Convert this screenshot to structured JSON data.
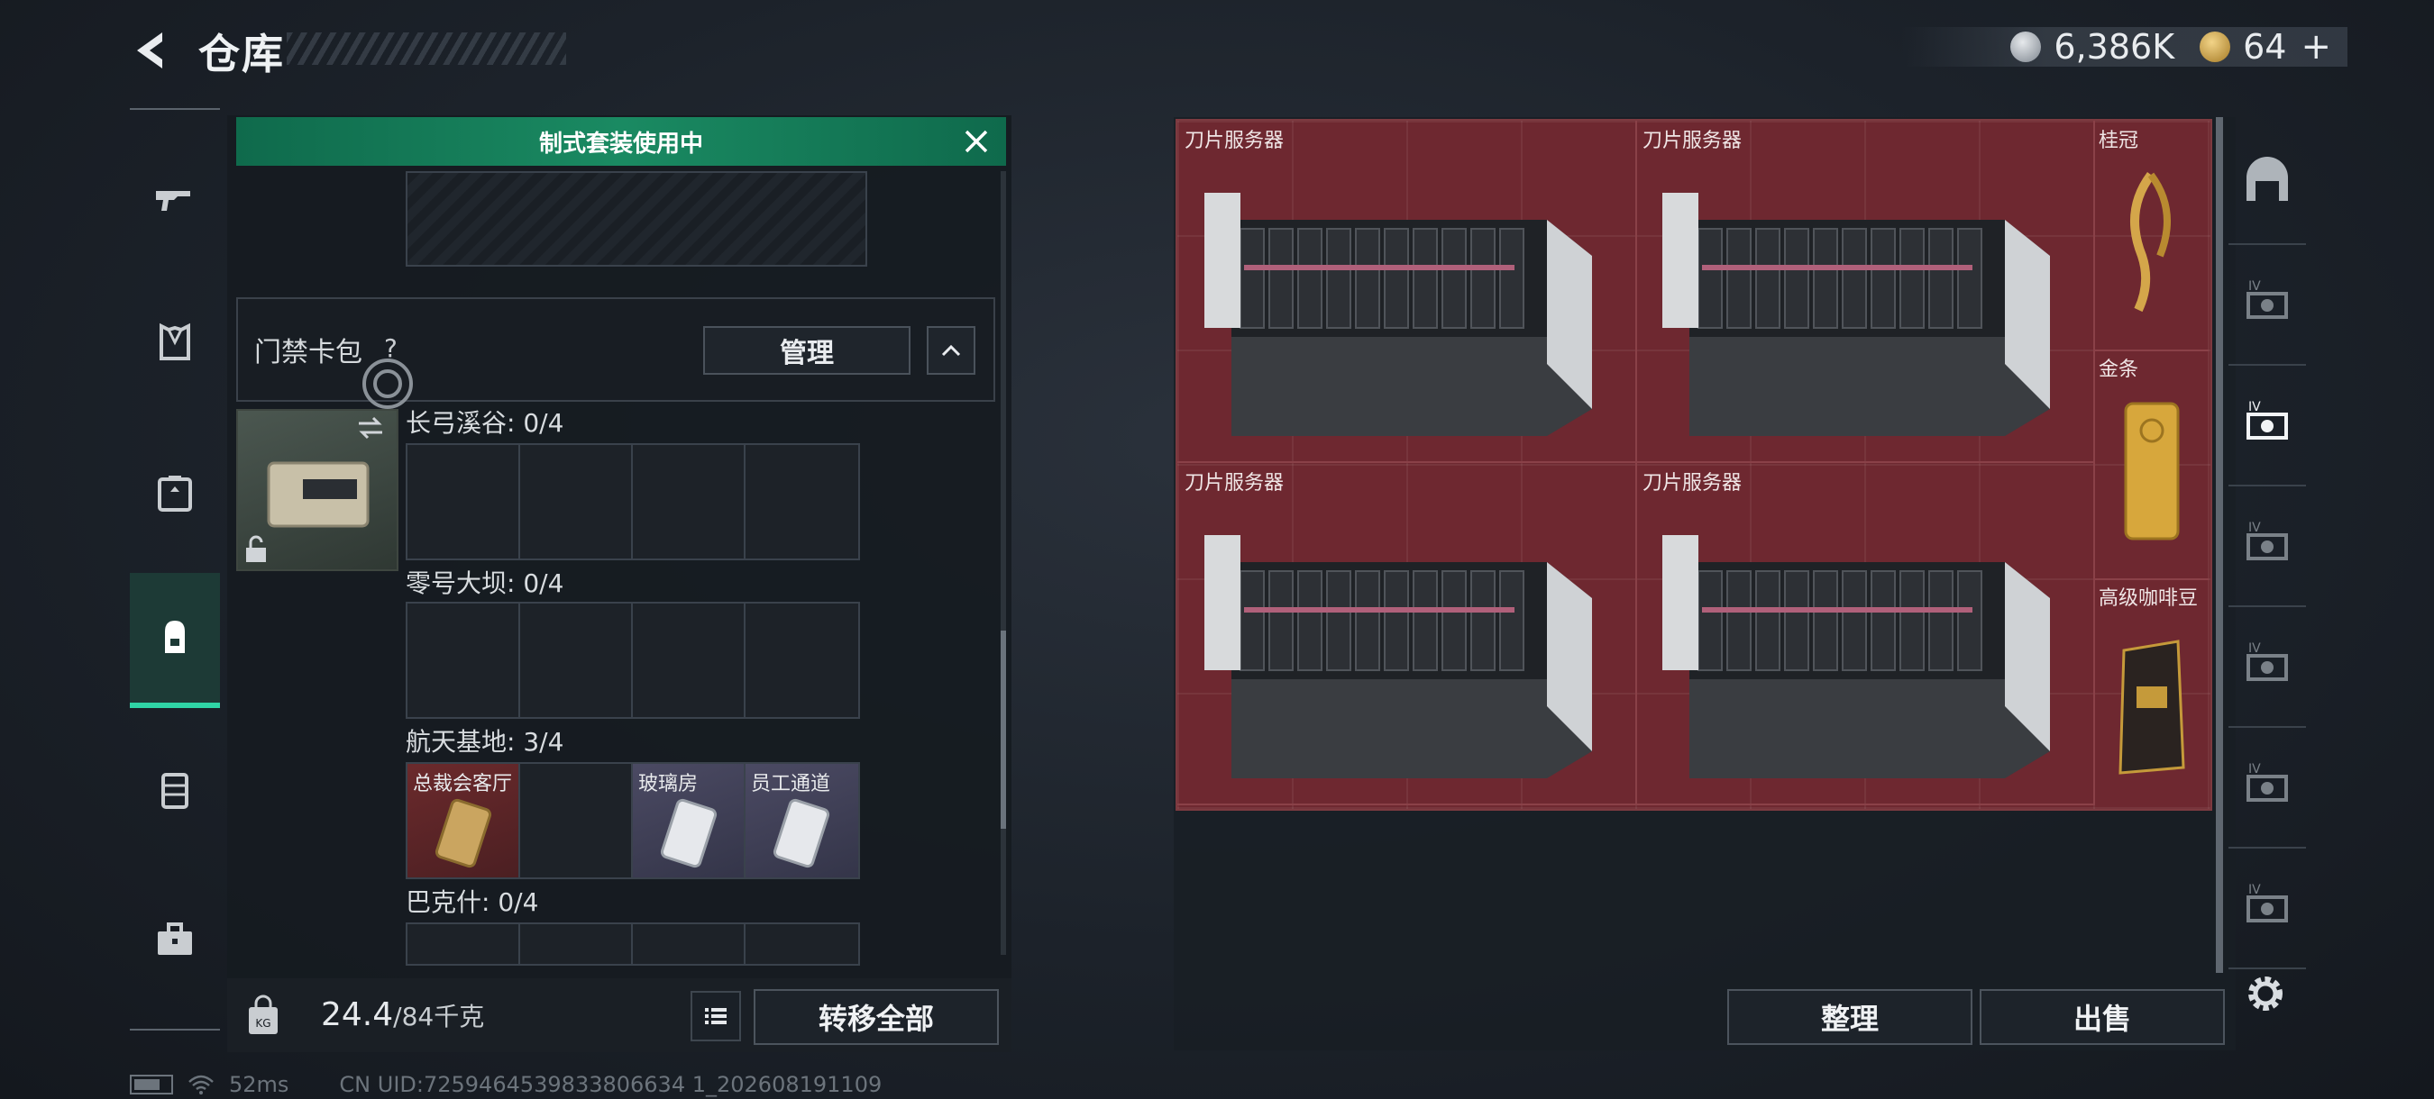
{
  "header": {
    "title": "仓库",
    "currency_silver": "6,386K",
    "currency_gold": "64",
    "currency_plus": "+"
  },
  "left_nav": {
    "items": [
      "weapon-icon",
      "armor-icon",
      "chest-rig-icon",
      "backpack-icon",
      "case-icon",
      "toolbox-icon"
    ],
    "active": "backpack-icon"
  },
  "inventory": {
    "banner": "制式套装使用中",
    "cardpack_label": "门禁卡包",
    "help_mark": "?",
    "manage_label": "管理",
    "sections": [
      {
        "label": "长弓溪谷: 0/4",
        "cells": [
          "",
          "",
          "",
          ""
        ]
      },
      {
        "label": "零号大坝: 0/4",
        "cells": [
          "",
          "",
          "",
          ""
        ]
      },
      {
        "label": "航天基地: 3/4",
        "cells": [
          "总裁会客厅",
          "",
          "玻璃房",
          "员工通道"
        ]
      },
      {
        "label": "巴克什: 0/4",
        "cells": [
          "",
          "",
          "",
          ""
        ]
      }
    ],
    "weight_current": "24.4",
    "weight_max": "/84千克",
    "transfer_all_label": "转移全部"
  },
  "stash": {
    "servers": [
      "刀片服务器",
      "刀片服务器",
      "刀片服务器",
      "刀片服务器"
    ],
    "side_items": [
      "桂冠",
      "金条",
      "高级咖啡豆"
    ],
    "sort_label": "整理",
    "sell_label": "出售"
  },
  "status_bar": {
    "ping": "52ms",
    "uid": "CN UID:7259464539833806634 1_202608191109"
  },
  "right_nav": {
    "items": [
      "safehouse-icon",
      "stash-tab-IV-icon",
      "stash-tab-IV-icon",
      "stash-tab-IV-icon",
      "stash-tab-IV-icon",
      "stash-tab-IV-icon",
      "stash-tab-IV-icon"
    ],
    "active_index": 2
  },
  "colors": {
    "accent": "#2fd5a6",
    "banner": "#1a8a62",
    "stash_red": "#6e2830"
  }
}
